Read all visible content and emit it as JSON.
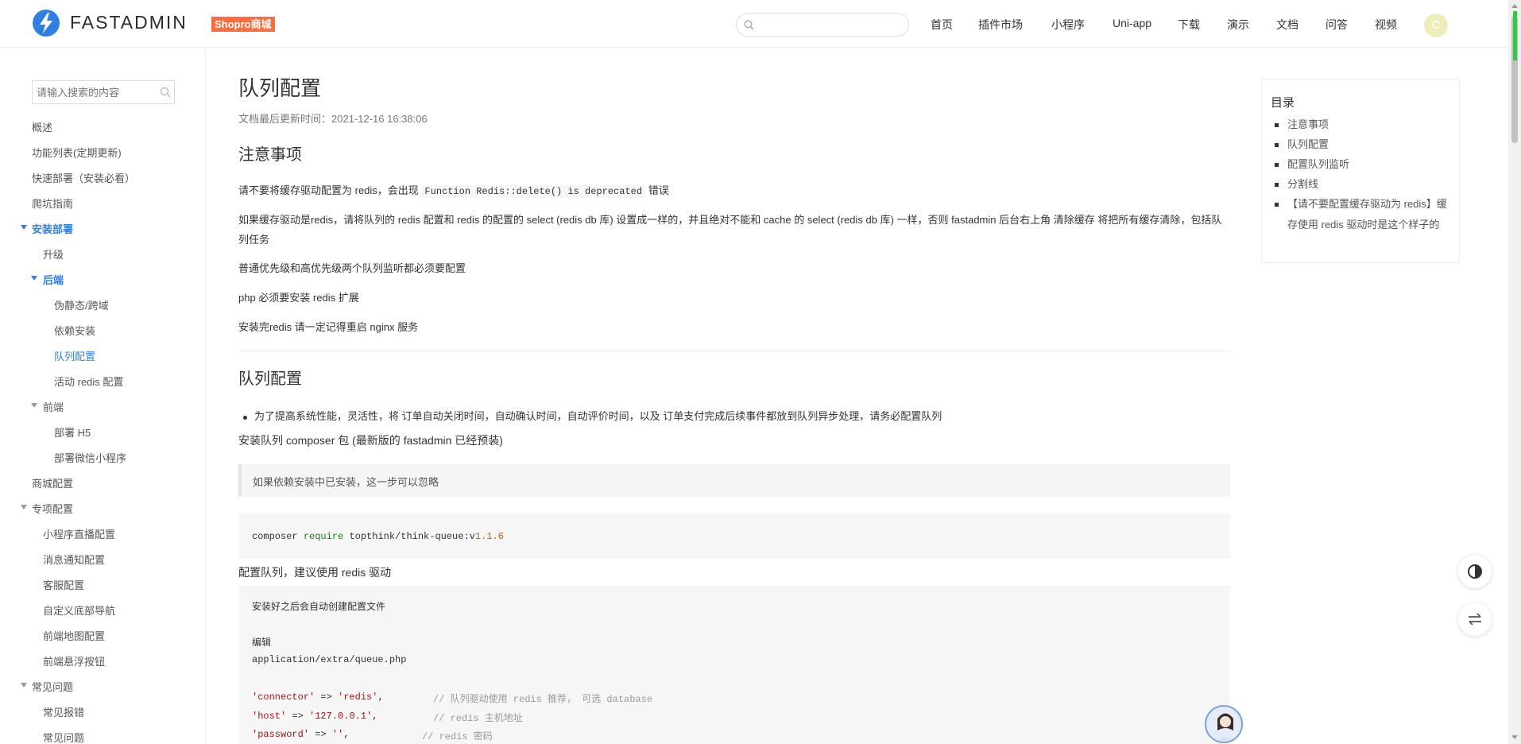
{
  "header": {
    "logo_text": "FASTADMIN",
    "badge": "Shopro商城",
    "search_placeholder": "",
    "nav": [
      "首页",
      "插件市场",
      "小程序",
      "Uni-app",
      "下载",
      "演示",
      "文档",
      "问答",
      "视频"
    ],
    "avatar_letter": "C"
  },
  "sidebar": {
    "search_placeholder": "请输入搜索的内容",
    "items": [
      {
        "label": "概述",
        "level": 0
      },
      {
        "label": "功能列表(定期更新)",
        "level": 0
      },
      {
        "label": "快速部署（安装必看）",
        "level": 0
      },
      {
        "label": "爬坑指南",
        "level": 0
      },
      {
        "label": "安装部署",
        "level": 0,
        "state": "expanded-active"
      },
      {
        "label": "升级",
        "level": 1
      },
      {
        "label": "后端",
        "level": 1,
        "state": "expanded-active"
      },
      {
        "label": "伪静态/跨域",
        "level": 2
      },
      {
        "label": "依赖安装",
        "level": 2
      },
      {
        "label": "队列配置",
        "level": 2,
        "state": "current"
      },
      {
        "label": "活动 redis 配置",
        "level": 2
      },
      {
        "label": "前端",
        "level": 1,
        "state": "expanded"
      },
      {
        "label": "部署 H5",
        "level": 2
      },
      {
        "label": "部署微信小程序",
        "level": 2
      },
      {
        "label": "商城配置",
        "level": 0
      },
      {
        "label": "专项配置",
        "level": 0,
        "state": "expanded"
      },
      {
        "label": "小程序直播配置",
        "level": 1
      },
      {
        "label": "消息通知配置",
        "level": 1
      },
      {
        "label": "客服配置",
        "level": 1
      },
      {
        "label": "自定义底部导航",
        "level": 1
      },
      {
        "label": "前端地图配置",
        "level": 1
      },
      {
        "label": "前端悬浮按钮",
        "level": 1
      },
      {
        "label": "常见问题",
        "level": 0,
        "state": "expanded"
      },
      {
        "label": "常见报错",
        "level": 1
      },
      {
        "label": "常见问题",
        "level": 1
      }
    ]
  },
  "main": {
    "title": "队列配置",
    "updated": "文档最后更新时间：2021-12-16 16:38:06",
    "section1_title": "注意事项",
    "p1_before": "请不要将缓存驱动配置为 redis，会出现",
    "p1_code": "Function Redis::delete() is deprecated",
    "p1_after": "错误",
    "p2": "如果缓存驱动是redis，请将队列的 redis 配置和 redis 的配置的 select (redis db 库) 设置成一样的，并且绝对不能和 cache 的 select (redis db 库) 一样，否则 fastadmin 后台右上角 清除缓存 将把所有缓存清除，包括队列任务",
    "p3": "普通优先级和高优先级两个队列监听都必须要配置",
    "p4": "php 必须要安装 redis 扩展",
    "p5": "安装完redis 请一定记得重启 nginx 服务",
    "section2_title": "队列配置",
    "bullet1": "为了提高系统性能，灵活性，将 订单自动关闭时间，自动确认时间，自动评价时间，以及 订单支付完成后续事件都放到队列异步处理，请务必配置队列",
    "p6": "安装队列 composer 包 (最新版的 fastadmin 已经预装)",
    "quote": "如果依赖安装中已安装，这一步可以忽略",
    "code1": {
      "cmd": "composer",
      "kw": "require",
      "pkg": "topthink/think-queue:v",
      "ver": "1.1.6"
    },
    "p7": "配置队列，建议使用 redis 驱动",
    "code2": {
      "l1": "安装好之后会自动创建配置文件",
      "l2": "编辑",
      "l3": "application/extra/queue.php",
      "l4_key": "'connector'",
      "l4_arrow": " => ",
      "l4_val": "'redis'",
      "l4_rest": ",",
      "l4_cm": "// 队列驱动使用 redis 推荐， 可选 database",
      "l5_key": "'host'",
      "l5_arrow": " => ",
      "l5_val": "'127.0.0.1'",
      "l5_rest": ",",
      "l5_cm": "// redis 主机地址",
      "l6_key": "'password'",
      "l6_arrow": " => ",
      "l6_val": "''",
      "l6_rest": ",",
      "l6_cm": "// redis 密码"
    }
  },
  "toc": {
    "title": "目录",
    "items": [
      "注意事项",
      "队列配置",
      "配置队列监听",
      "分割线",
      "【请不要配置缓存驱动为 redis】缓存使用 redis 驱动时是这个样子的"
    ]
  },
  "colors": {
    "accent": "#2e7fe2",
    "badge": "#ff6b3a",
    "logo": "#2e7fe2"
  }
}
